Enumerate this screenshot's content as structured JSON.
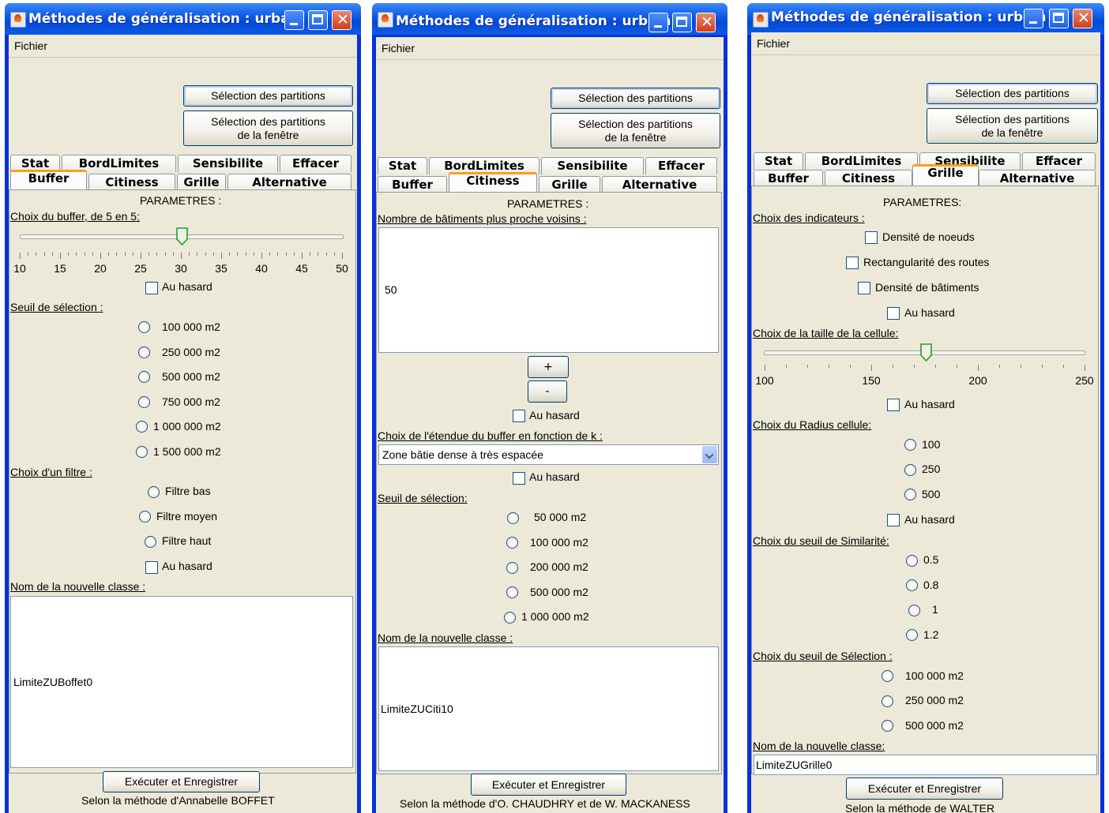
{
  "windows": [
    {
      "title": "Méthodes de généralisation : urbain",
      "menu": "Fichier",
      "btn_partitions": "Sélection des partitions",
      "btn_partitions_window": "Sélection des partitions\nde la fenêtre",
      "tabs_row1": [
        "Stat",
        "BordLimites",
        "Sensibilite",
        "Effacer"
      ],
      "tabs_row2": [
        "Buffer",
        "Citiness",
        "Grille",
        "Alternative"
      ],
      "active_tab": "Buffer",
      "params_title": "PARAMETRES :",
      "buffer_label": "Choix du buffer, de 5 en 5:",
      "slider": {
        "min": 10,
        "max": 50,
        "value": 30,
        "labels": [
          "10",
          "15",
          "20",
          "25",
          "30",
          "35",
          "40",
          "45",
          "50"
        ]
      },
      "random1": "Au hasard",
      "threshold_label": "Seuil de sélection :",
      "thresholds": [
        "100 000 m2",
        "250 000 m2",
        "500 000 m2",
        "750 000 m2",
        "1 000 000 m2",
        "1 500 000 m2"
      ],
      "filter_label": "Choix d'un filtre :",
      "filters": [
        "Filtre bas",
        "Filtre moyen",
        "Filtre haut"
      ],
      "random2": "Au hasard",
      "class_label": "Nom de la nouvelle classe :",
      "class_value": "LimiteZUBoffet0",
      "run_button": "Exécuter et Enregistrer",
      "footer": "Selon la méthode d'Annabelle BOFFET"
    },
    {
      "title": "Méthodes de généralisation : urbain",
      "menu": "Fichier",
      "btn_partitions": "Sélection des partitions",
      "btn_partitions_window": "Sélection des partitions\nde la fenêtre",
      "tabs_row1": [
        "Stat",
        "BordLimites",
        "Sensibilite",
        "Effacer"
      ],
      "tabs_row2": [
        "Buffer",
        "Citiness",
        "Grille",
        "Alternative"
      ],
      "active_tab": "Citiness",
      "params_title": "PARAMETRES :",
      "neighbors_label": "Nombre de bâtiments plus proche voisins :",
      "neighbors_value": "50",
      "plus": "+",
      "minus": "-",
      "random1": "Au hasard",
      "extent_label": "Choix de l'étendue du buffer en fonction de k :",
      "extent_value": "Zone bâtie dense à très espacée",
      "random2": "Au hasard",
      "threshold_label": "Seuil de sélection:",
      "thresholds": [
        "50 000 m2",
        "100 000 m2",
        "200 000 m2",
        "500 000 m2",
        "1 000 000 m2"
      ],
      "class_label": "Nom de la nouvelle classe :",
      "class_value": "LimiteZUCiti10",
      "run_button": "Exécuter et Enregistrer",
      "footer": "Selon la méthode d'O. CHAUDHRY et de W. MACKANESS"
    },
    {
      "title": "Méthodes de généralisation : urbain",
      "menu": "Fichier",
      "btn_partitions": "Sélection des partitions",
      "btn_partitions_window": "Sélection des partitions\nde la fenêtre",
      "tabs_row1": [
        "Stat",
        "BordLimites",
        "Sensibilite",
        "Effacer"
      ],
      "tabs_row2": [
        "Buffer",
        "Citiness",
        "Grille",
        "Alternative"
      ],
      "active_tab": "Grille",
      "params_title": "PARAMETRES:",
      "indicators_label": "Choix des indicateurs :",
      "indicators": [
        "Densité de noeuds",
        "Rectangularité des routes",
        "Densité de bâtiments"
      ],
      "random1": "Au hasard",
      "cell_label": "Choix de la taille de la cellule:",
      "slider": {
        "min": 100,
        "max": 250,
        "value": 175,
        "labels": [
          "100",
          "150",
          "200",
          "250"
        ]
      },
      "random2": "Au hasard",
      "radius_label": "Choix du Radius cellule:",
      "radii": [
        "100",
        "250",
        "500"
      ],
      "random3": "Au hasard",
      "similarity_label": "Choix du seuil de Similarité:",
      "similarities": [
        "0.5",
        "0.8",
        "1",
        "1.2"
      ],
      "selection_label": "Choix du seuil de Sélection :",
      "selections": [
        "100 000 m2",
        "250 000 m2",
        "500 000 m2"
      ],
      "class_label": "Nom de la nouvelle classe:",
      "class_value": "LimiteZUGrille0",
      "run_button": "Exécuter et Enregistrer",
      "footer": "Selon la méthode de WALTER"
    }
  ]
}
